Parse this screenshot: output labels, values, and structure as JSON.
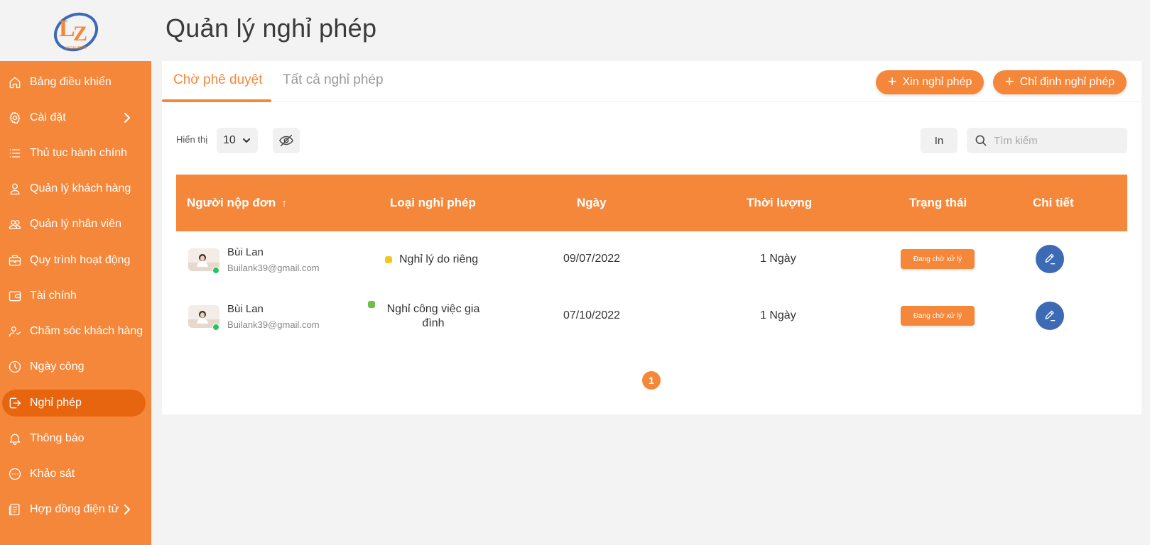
{
  "brand": {
    "logo_text": "LEGALZONE",
    "accent": "#f5873a",
    "active": "#e8650f",
    "edit": "#3d6ab5"
  },
  "page": {
    "title": "Quản lý nghỉ phép"
  },
  "sidebar": {
    "items": [
      {
        "label": "Bảng điều khiển",
        "icon": "home-icon"
      },
      {
        "label": "Cài đặt",
        "icon": "gear-icon",
        "has_submenu": true
      },
      {
        "label": "Thủ tục hành chính",
        "icon": "list-icon"
      },
      {
        "label": "Quản lý khách hàng",
        "icon": "user-icon"
      },
      {
        "label": "Quản lý nhân viên",
        "icon": "users-icon"
      },
      {
        "label": "Quy trình hoạt động",
        "icon": "briefcase-icon"
      },
      {
        "label": "Tài chính",
        "icon": "wallet-icon"
      },
      {
        "label": "Chăm sóc khách hàng",
        "icon": "support-icon"
      },
      {
        "label": "Ngày công",
        "icon": "clock-icon"
      },
      {
        "label": "Nghỉ phép",
        "icon": "logout-icon",
        "active": true
      },
      {
        "label": "Thông báo",
        "icon": "bell-icon"
      },
      {
        "label": "Khảo sát",
        "icon": "chat-icon"
      },
      {
        "label": "Hợp đồng điện tử",
        "icon": "document-icon",
        "has_submenu": true
      }
    ]
  },
  "tabs": {
    "pending": "Chờ phê duyệt",
    "all": "Tất cả nghỉ phép"
  },
  "actions": {
    "request_leave": "Xin nghỉ phép",
    "assign_leave": "Chỉ định nghỉ phép",
    "print": "In"
  },
  "toolbar": {
    "show_label": "Hiển thị",
    "page_size": "10",
    "search_placeholder": "Tìm kiếm"
  },
  "table": {
    "headers": {
      "applicant": "Người nộp đơn",
      "sort_indicator": "↑",
      "type": "Loại nghỉ phép",
      "date": "Ngày",
      "duration": "Thời lượng",
      "status": "Trạng thái",
      "detail": "Chi tiết"
    },
    "rows": [
      {
        "name": "Bùi Lan",
        "email": "Builank39@gmail.com",
        "type": "Nghỉ lý do riêng",
        "type_color": "#f2c81f",
        "date": "09/07/2022",
        "duration": "1 Ngày",
        "status": "Đang chờ xử lý"
      },
      {
        "name": "Bùi Lan",
        "email": "Builank39@gmail.com",
        "type": "Nghỉ công việc gia đình",
        "type_color": "#6fbf4a",
        "date": "07/10/2022",
        "duration": "1 Ngày",
        "status": "Đang chờ xử lý"
      }
    ]
  },
  "pagination": {
    "current": "1"
  }
}
